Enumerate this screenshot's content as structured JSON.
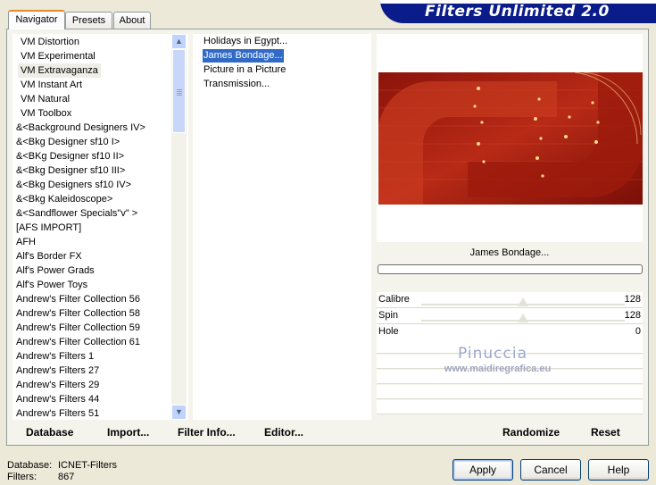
{
  "header": {
    "title": "Filters Unlimited 2.0",
    "tabs": [
      "Navigator",
      "Presets",
      "About"
    ],
    "active_tab": "Navigator"
  },
  "categories": {
    "selected": "VM Extravaganza",
    "items": [
      "VM Distortion",
      "VM Experimental",
      "VM Extravaganza",
      "VM Instant Art",
      "VM Natural",
      "VM Toolbox",
      "&<Background Designers IV>",
      "&<Bkg Designer sf10 I>",
      "&<BKg Designer sf10 II>",
      "&<Bkg Designer sf10 III>",
      "&<Bkg Designers sf10 IV>",
      "&<Bkg Kaleidoscope>",
      "&<Sandflower Specials\"v\" >",
      "[AFS IMPORT]",
      "AFH",
      "Alf's Border FX",
      "Alf's Power Grads",
      "Alf's Power Toys",
      "Andrew's Filter Collection 56",
      "Andrew's Filter Collection 58",
      "Andrew's Filter Collection 59",
      "Andrew's Filter Collection 61",
      "Andrew's Filters 1",
      "Andrew's Filters 27",
      "Andrew's Filters 29",
      "Andrew's Filters 44",
      "Andrew's Filters 51"
    ]
  },
  "filters": {
    "selected": "James Bondage...",
    "items": [
      "Holidays in Egypt...",
      "James Bondage...",
      "Picture in a Picture",
      "Transmission..."
    ]
  },
  "preview": {
    "filter_name": "James Bondage..."
  },
  "params": [
    {
      "name": "Calibre",
      "value": "128",
      "level": 0.5
    },
    {
      "name": "Spin",
      "value": "128",
      "level": 0.5
    },
    {
      "name": "Hole",
      "value": "0",
      "level": 0
    }
  ],
  "actions": {
    "database": "Database",
    "import": "Import...",
    "filter_info": "Filter Info...",
    "editor": "Editor...",
    "randomize": "Randomize",
    "reset": "Reset"
  },
  "watermark": {
    "name": "Pinuccia",
    "url": "www.maidiregrafica.eu"
  },
  "status": {
    "database_label": "Database:",
    "database_value": "ICNET-Filters",
    "filters_label": "Filters:",
    "filters_value": "867"
  },
  "buttons": {
    "apply": "Apply",
    "cancel": "Cancel",
    "help": "Help"
  },
  "colors": {
    "title_bar": "#0a1b8a",
    "selection": "#316ac5",
    "preview_red": "#b22414"
  }
}
